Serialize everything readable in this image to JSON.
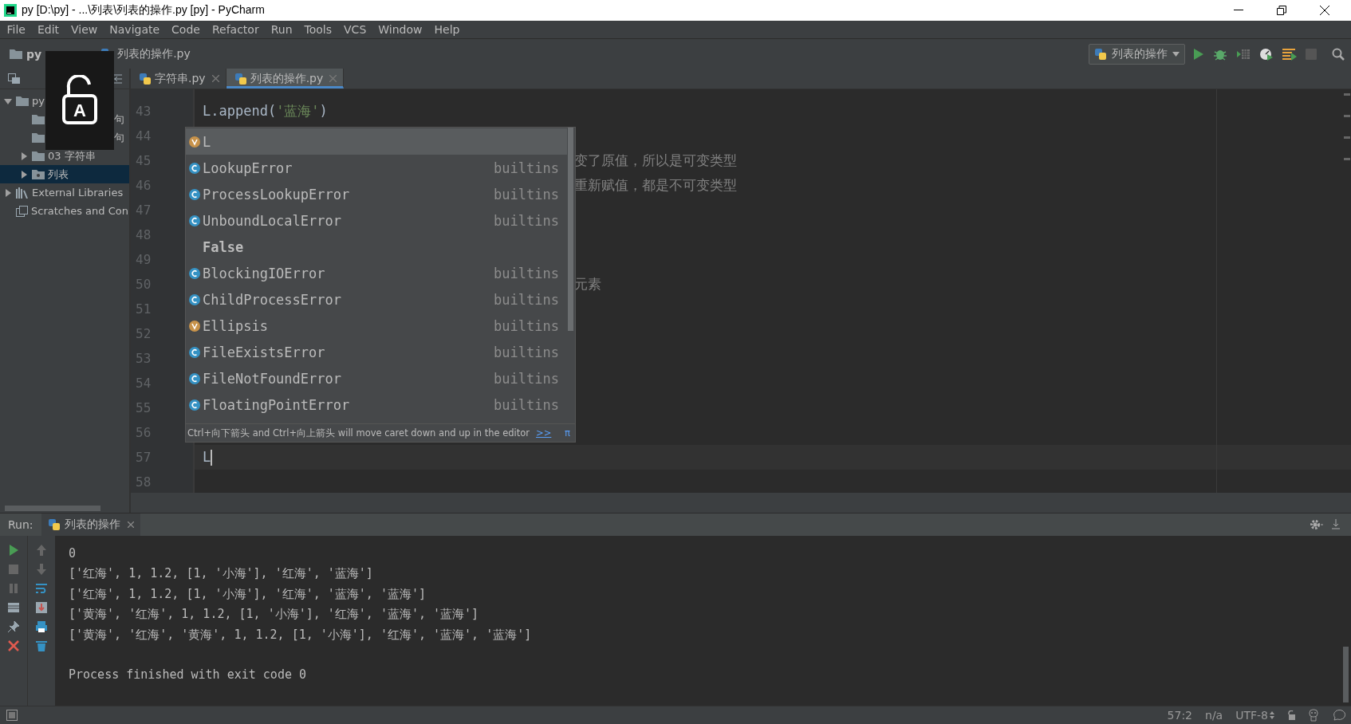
{
  "window": {
    "title": "py [D:\\py] - ...\\列表\\列表的操作.py [py] - PyCharm"
  },
  "menu": [
    "File",
    "Edit",
    "View",
    "Navigate",
    "Code",
    "Refactor",
    "Run",
    "Tools",
    "VCS",
    "Window",
    "Help"
  ],
  "breadcrumbs": [
    {
      "label": "py",
      "kind": "folder"
    },
    {
      "label": "列表的操作.py",
      "kind": "file"
    }
  ],
  "run_config": {
    "label": "列表的操作"
  },
  "project_tree": [
    {
      "label": "py",
      "kind": "folder",
      "expanded": true,
      "selected": false,
      "children": [
        {
          "label": "句",
          "kind": "partial",
          "selected": false
        },
        {
          "label": "句",
          "kind": "partial",
          "selected": false
        },
        {
          "label": "03 字符串",
          "kind": "folder",
          "expanded": false,
          "selected": false
        },
        {
          "label": "列表",
          "kind": "package",
          "expanded": false,
          "selected": true
        }
      ]
    },
    {
      "label": "External Libraries",
      "kind": "libraries",
      "expanded": false,
      "selected": false
    },
    {
      "label": "Scratches and Con",
      "kind": "scratches",
      "selected": false
    }
  ],
  "tabs": [
    {
      "label": "字符串.py",
      "selected": false
    },
    {
      "label": "列表的操作.py",
      "selected": true
    }
  ],
  "code_lines": [
    {
      "number": "43",
      "kind": "code",
      "segments": [
        {
          "text": "L.append(",
          "kind": "plain"
        },
        {
          "text": "'蓝海'",
          "kind": "string"
        },
        {
          "text": ")",
          "kind": "plain"
        }
      ]
    },
    {
      "number": "44",
      "kind": "blank"
    },
    {
      "number": "45",
      "kind": "tail",
      "text": "变了原值，所以是可变类型"
    },
    {
      "number": "46",
      "kind": "tail",
      "text": "重新赋值，都是不可变类型"
    },
    {
      "number": "47",
      "kind": "blank"
    },
    {
      "number": "48",
      "kind": "blank"
    },
    {
      "number": "49",
      "kind": "blank"
    },
    {
      "number": "50",
      "kind": "tail",
      "text": "元素"
    },
    {
      "number": "51",
      "kind": "blank"
    },
    {
      "number": "52",
      "kind": "blank"
    },
    {
      "number": "53",
      "kind": "blank"
    },
    {
      "number": "54",
      "kind": "blank"
    },
    {
      "number": "55",
      "kind": "blank"
    },
    {
      "number": "56",
      "kind": "blank"
    },
    {
      "number": "57",
      "kind": "cursor",
      "segments": [
        {
          "text": "L",
          "kind": "plain"
        }
      ]
    },
    {
      "number": "58",
      "kind": "blank"
    }
  ],
  "completion": {
    "items": [
      {
        "label": "L",
        "kind": "variable",
        "selected": true
      },
      {
        "label": "LookupError",
        "kind": "class",
        "source": "builtins",
        "selected": false
      },
      {
        "label": "ProcessLookupError",
        "kind": "class",
        "source": "builtins",
        "selected": false
      },
      {
        "label": "UnboundLocalError",
        "kind": "class",
        "source": "builtins",
        "selected": false
      },
      {
        "label": "False",
        "kind": "keyword",
        "selected": false
      },
      {
        "label": "BlockingIOError",
        "kind": "class",
        "source": "builtins",
        "selected": false
      },
      {
        "label": "ChildProcessError",
        "kind": "class",
        "source": "builtins",
        "selected": false
      },
      {
        "label": "Ellipsis",
        "kind": "variable",
        "source": "builtins",
        "selected": false
      },
      {
        "label": "FileExistsError",
        "kind": "class",
        "source": "builtins",
        "selected": false
      },
      {
        "label": "FileNotFoundError",
        "kind": "class",
        "source": "builtins",
        "selected": false
      },
      {
        "label": "FloatingPointError",
        "kind": "class",
        "source": "builtins",
        "selected": false
      }
    ],
    "hint": "Ctrl+向下箭头 and Ctrl+向上箭头 will move caret down and up in the editor",
    "hint_link": ">>",
    "pi": "π"
  },
  "run_panel": {
    "label": "Run:",
    "tab": "列表的操作",
    "lines": [
      {
        "text": "0",
        "kind": "output"
      },
      {
        "text": "['红海', 1, 1.2, [1, '小海'], '红海', '蓝海']",
        "kind": "output"
      },
      {
        "text": "['红海', 1, 1.2, [1, '小海'], '红海', '蓝海', '蓝海']",
        "kind": "output"
      },
      {
        "text": "['黄海', '红海', 1, 1.2, [1, '小海'], '红海', '蓝海', '蓝海']",
        "kind": "output"
      },
      {
        "text": "['黄海', '红海', '黄海', 1, 1.2, [1, '小海'], '红海', '蓝海', '蓝海']",
        "kind": "output"
      },
      {
        "text": "Process finished with exit code 0",
        "kind": "exit"
      }
    ]
  },
  "status_bar": {
    "position": "57:2",
    "line_separator": "n/a",
    "encoding": "UTF-8"
  },
  "caps_lock": {
    "letter": "A"
  }
}
